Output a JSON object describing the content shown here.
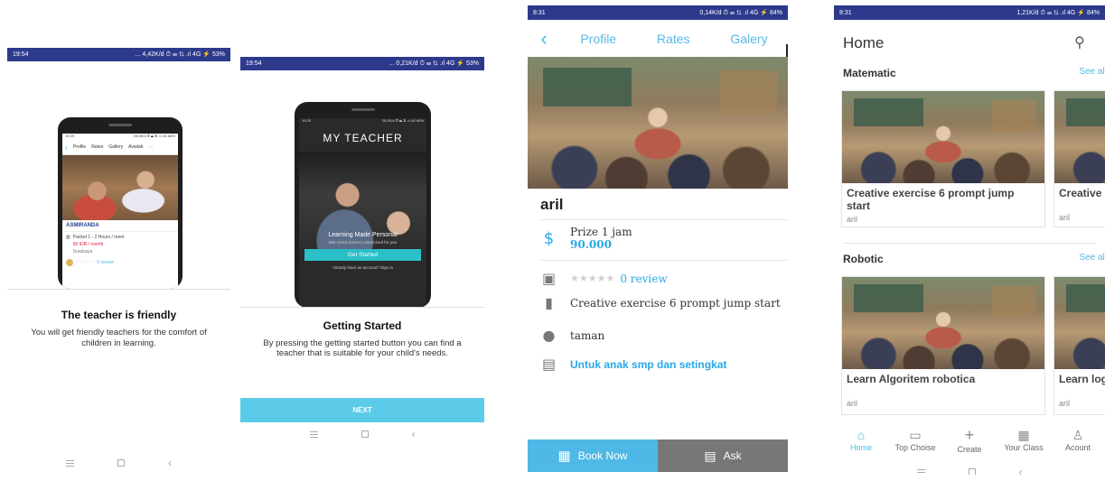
{
  "screen1": {
    "status_time": "19:54",
    "status_right": "... 4,42K/d ⏱ ☰ ⇅ .ıl 4G ⚡ 53%",
    "mock": {
      "status_time": "19:29",
      "status_right": "25,0K/d ⏱ ☰ ⇅ .ıl 4G 66%",
      "tabs": [
        "Profile",
        "Rates",
        "Gallery",
        "Availab"
      ],
      "teacher_name": "ASMIRANDA",
      "packet": "Packet 1 - 2 Hours / meet",
      "price": "60 IDR / month",
      "city": "Surabaya",
      "review": "0 review"
    },
    "title": "The teacher is friendly",
    "description": "You will get friendly teachers for the comfort of children in learning."
  },
  "screen2": {
    "status_time": "19:54",
    "status_right": "... 0,21K/d ⏱ ☰ ⇅ .ıl 4G ⚡ 53%",
    "mock": {
      "status_time": "19:29",
      "status_right": "25,0K/d ⏱ ☰ ⇅ .ıl 4G 66%",
      "app_title": "MY TEACHER",
      "tagline": "Learning Made Personal",
      "sub_tagline": "Bite-sized classes customized for you",
      "cta": "Get Started",
      "signin": "Already have an account? Sign In"
    },
    "title": "Getting Started",
    "description": "By pressing the getting started button you can find a teacher that is suitable for your child's needs.",
    "next_label": "NEXT"
  },
  "screen3": {
    "status_time": "8:31",
    "status_right": "0,14K/d ⏱ ☰ ⇅ .ıl 4G ⚡ 84%",
    "tabs": [
      "Profile",
      "Rates",
      "Galery"
    ],
    "name": "aril",
    "prize_label": "Prize 1 jam",
    "prize_value": "90.000",
    "review": "0 review",
    "class_title": "Creative exercise 6 prompt jump start",
    "location": "taman",
    "audience": "Untuk anak smp dan setingkat",
    "book_label": "Book Now",
    "ask_label": "Ask"
  },
  "screen4": {
    "status_time": "8:31",
    "status_right": "1,21K/d ⏱ ☰ ⇅ .ıl 4G ⚡ 84%",
    "title": "Home",
    "see_all": "See all",
    "sections": [
      {
        "name": "Matematic",
        "cards": [
          {
            "title": "Creative exercise 6 prompt jump start",
            "author": "aril"
          },
          {
            "title": "Creative",
            "author": "aril"
          }
        ]
      },
      {
        "name": "Robotic",
        "cards": [
          {
            "title": "Learn Algoritem robotica",
            "author": "aril"
          },
          {
            "title": "Learn log",
            "author": "aril"
          }
        ]
      }
    ],
    "bottom_nav": [
      "Home",
      "Top Choise",
      "Create",
      "Your Class",
      "Acount"
    ]
  }
}
